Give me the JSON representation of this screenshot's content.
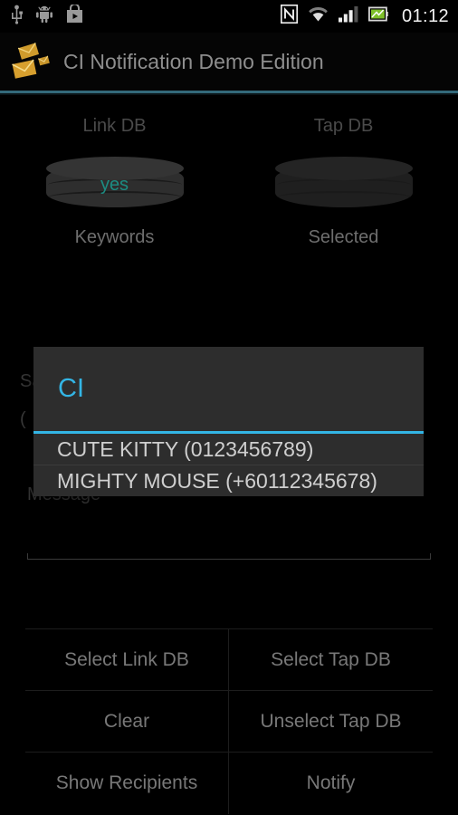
{
  "statusbar": {
    "time": "01:12",
    "left_icons": [
      {
        "name": "usb-icon",
        "label": "USB"
      },
      {
        "name": "android-debug-icon",
        "label": "Android"
      },
      {
        "name": "play-store-icon",
        "label": "Play Store"
      }
    ],
    "right_icons": [
      {
        "name": "nfc-icon",
        "label": "NFC"
      },
      {
        "name": "wifi-icon",
        "label": "Wi-Fi"
      },
      {
        "name": "cellular-signal-icon",
        "label": "Signal"
      },
      {
        "name": "battery-icon",
        "label": "Battery"
      }
    ]
  },
  "actionbar": {
    "icon_name": "envelopes-app-icon",
    "title": "CI Notification Demo Edition",
    "divider_color": "#33697a"
  },
  "db_section": {
    "link_db": {
      "top_label": "Link DB",
      "value": "yes",
      "value_color": "#1c8c82",
      "bottom_label": "Keywords",
      "icon_name": "database-cylinder-icon"
    },
    "tap_db": {
      "top_label": "Tap DB",
      "value": "",
      "bottom_label": "Selected",
      "icon_name": "database-cylinder-icon"
    }
  },
  "form": {
    "obscured_label_1": "Sa",
    "obscured_label_2": "(",
    "message_label": "Message",
    "message_value": ""
  },
  "dialog": {
    "title": "CI",
    "title_color": "#33b5e5",
    "items": [
      "CUTE KITTY (0123456789)",
      "MIGHTY MOUSE (+60112345678)"
    ]
  },
  "buttons": {
    "rows": [
      [
        {
          "label": "Select Link DB",
          "name": "select-link-db-button"
        },
        {
          "label": "Select Tap DB",
          "name": "select-tap-db-button"
        }
      ],
      [
        {
          "label": "Clear",
          "name": "clear-button"
        },
        {
          "label": "Unselect Tap DB",
          "name": "unselect-tap-db-button"
        }
      ],
      [
        {
          "label": "Show Recipients",
          "name": "show-recipients-button"
        },
        {
          "label": "Notify",
          "name": "notify-button"
        }
      ]
    ]
  }
}
